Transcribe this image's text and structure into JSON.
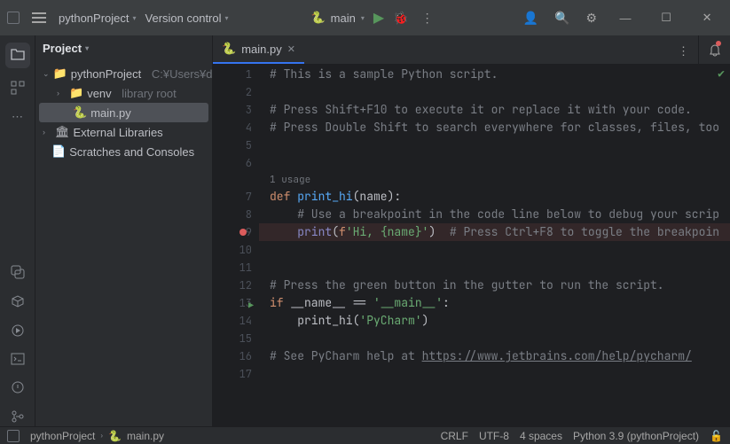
{
  "titlebar": {
    "project_name": "pythonProject",
    "version_control": "Version control",
    "run_config": "main"
  },
  "panel": {
    "title": "Project"
  },
  "tree": {
    "root": "pythonProject",
    "root_hint": "C:¥Users¥deve",
    "venv": "venv",
    "venv_hint": "library root",
    "main_file": "main.py",
    "external": "External Libraries",
    "scratches": "Scratches and Consoles"
  },
  "tab": {
    "name": "main.py"
  },
  "gutter_lines": [
    "1",
    "2",
    "3",
    "4",
    "5",
    "6",
    "",
    "7",
    "8",
    "9",
    "10",
    "11",
    "12",
    "13",
    "14",
    "15",
    "16",
    "17"
  ],
  "code": {
    "l1_comment": "# This is a sample Python script.",
    "l3_comment": "# Press Shift+F10 to execute it or replace it with your code.",
    "l4_comment": "# Press Double Shift to search everywhere for classes, files, too",
    "usage_hint": "1 usage",
    "l7_def": "def ",
    "l7_fn": "print_hi",
    "l7_params": "(name):",
    "l8_comment": "    # Use a breakpoint in the code line below to debug your scrip",
    "l9_print": "    print",
    "l9_paren_open": "(",
    "l9_f": "f",
    "l9_str": "'Hi, {name}'",
    "l9_paren_close": ")",
    "l9_tail": "  # Press Ctrl+F8 to toggle the breakpoin",
    "l12_comment": "# Press the green button in the gutter to run the script.",
    "l13_if": "if ",
    "l13_name": "__name__",
    "l13_eq": " == ",
    "l13_main": "'__main__'",
    "l13_colon": ":",
    "l14_call": "    print_hi(",
    "l14_arg": "'PyCharm'",
    "l14_close": ")",
    "l16_pre": "# See PyCharm help at ",
    "l16_url": "https://www.jetbrains.com/help/pycharm/"
  },
  "status": {
    "crumb_project": "pythonProject",
    "crumb_file": "main.py",
    "crlf": "CRLF",
    "encoding": "UTF-8",
    "indent": "4 spaces",
    "interpreter": "Python 3.9 (pythonProject)"
  }
}
